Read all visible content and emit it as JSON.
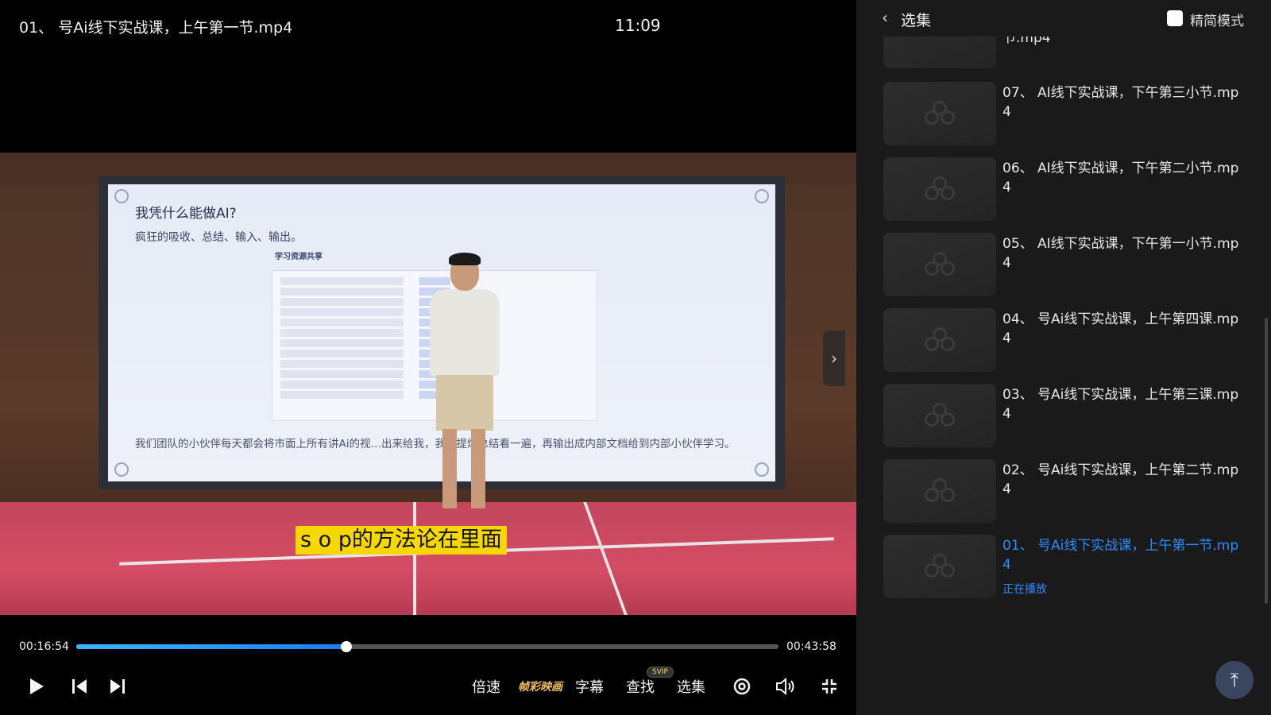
{
  "player": {
    "title": "01、 号Ai线下实战课，上午第一节.mp4",
    "clock": "11:09",
    "subtitle": "s o p的方法论在里面",
    "slide": {
      "title": "我凭什么能做AI?",
      "subtitle": "疯狂的吸收、总结、输入、输出。",
      "table_title": "学习资源共享",
      "body": "我们团队的小伙伴每天都会将市面上所有讲Ai的视…出来给我，我会提炼总结看一遍，再输出成内部文档给到内部小伙伴学习。"
    },
    "current_time": "00:16:54",
    "total_time": "00:43:58",
    "progress": 0.385
  },
  "controls": {
    "speed_label": "倍速",
    "brand_label": "帧彩映画",
    "subtitle_label": "字幕",
    "search_label": "查找",
    "svip_badge": "SVIP",
    "episodes_label": "选集"
  },
  "sidebar": {
    "title": "选集",
    "mode_label": "精简模式",
    "partial_item_title": "节.mp4",
    "items": [
      {
        "title": "07、 AI线下实战课，下午第三小节.mp4"
      },
      {
        "title": "06、 AI线下实战课，下午第二小节.mp4"
      },
      {
        "title": "05、 AI线下实战课，下午第一小节.mp4"
      },
      {
        "title": "04、 号Ai线下实战课，上午第四课.mp4"
      },
      {
        "title": "03、 号Ai线下实战课，上午第三课.mp4"
      },
      {
        "title": "02、 号Ai线下实战课，上午第二节.mp4"
      },
      {
        "title": "01、 号Ai线下实战课，上午第一节.mp4",
        "active": true
      }
    ],
    "now_playing": "正在播放"
  },
  "colors": {
    "accent": "#2a8cff",
    "subtitle_bg": "#f7d700",
    "sidebar_bg": "#1a1a1a"
  }
}
